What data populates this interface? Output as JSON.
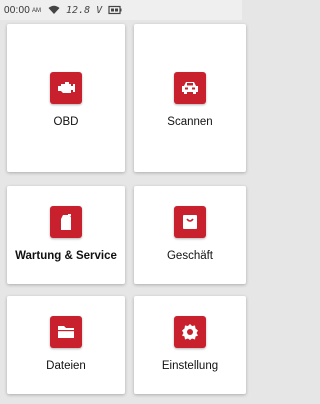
{
  "status": {
    "time": "00:00",
    "ampm": "AM",
    "voltage": "12.8 V",
    "icons": [
      "wifi-icon",
      "battery-icon"
    ]
  },
  "accent_color": "#c8202d",
  "tiles": [
    {
      "label": "OBD",
      "icon": "engine-icon"
    },
    {
      "label": "Scannen",
      "icon": "car-icon"
    },
    {
      "label": "Wartung & Service",
      "icon": "oil-can-icon"
    },
    {
      "label": "Geschäft",
      "icon": "shopping-bag-icon"
    },
    {
      "label": "Dateien",
      "icon": "folder-icon"
    },
    {
      "label": "Einstellung",
      "icon": "gear-icon"
    }
  ]
}
